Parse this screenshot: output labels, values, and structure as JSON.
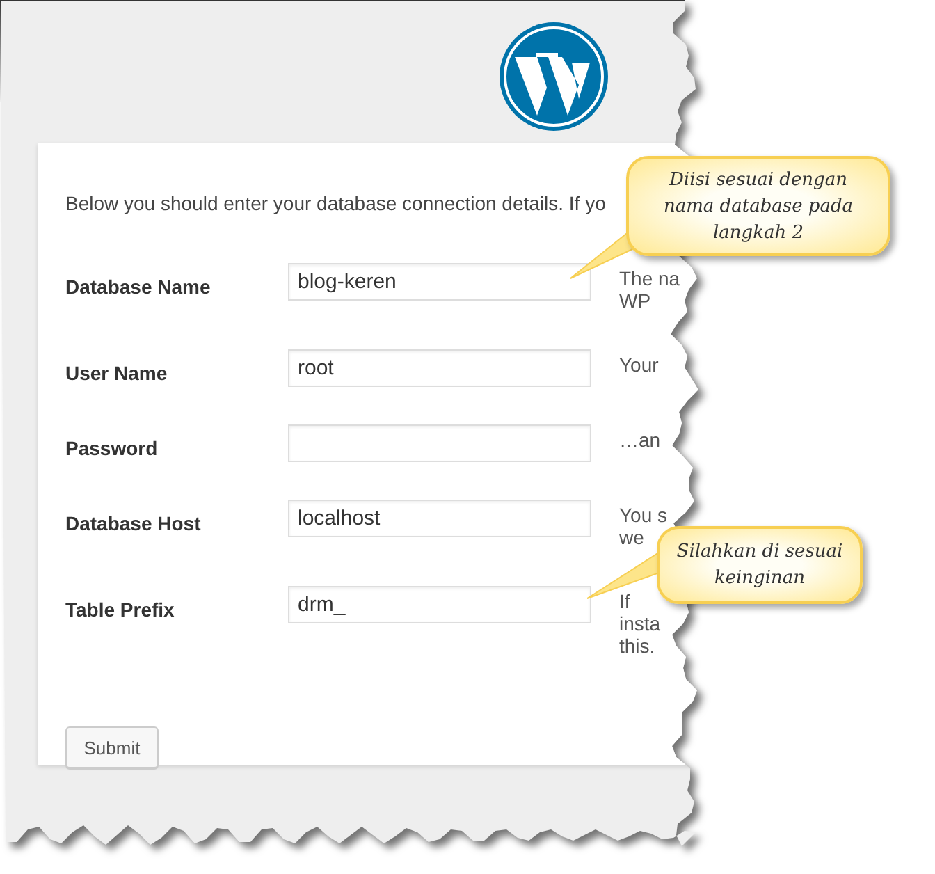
{
  "intro": "Below you should enter your database connection details. If yo",
  "fields": [
    {
      "label": "Database Name",
      "value": "blog-keren",
      "description": [
        "The na",
        "WP"
      ]
    },
    {
      "label": "User Name",
      "value": "root",
      "description": [
        "Your"
      ]
    },
    {
      "label": "Password",
      "description": [
        "…an"
      ]
    },
    {
      "label": "Database Host",
      "value": "localhost",
      "description": [
        "You s",
        "we"
      ]
    },
    {
      "label": "Table Prefix",
      "value": "drm_",
      "description": [
        "If",
        "insta",
        "this."
      ]
    }
  ],
  "submit": "Submit",
  "callouts": [
    {
      "text": "Diisi sesuai dengan nama database pada langkah 2"
    },
    {
      "text": "Silahkan di sesuai keinginan"
    }
  ]
}
